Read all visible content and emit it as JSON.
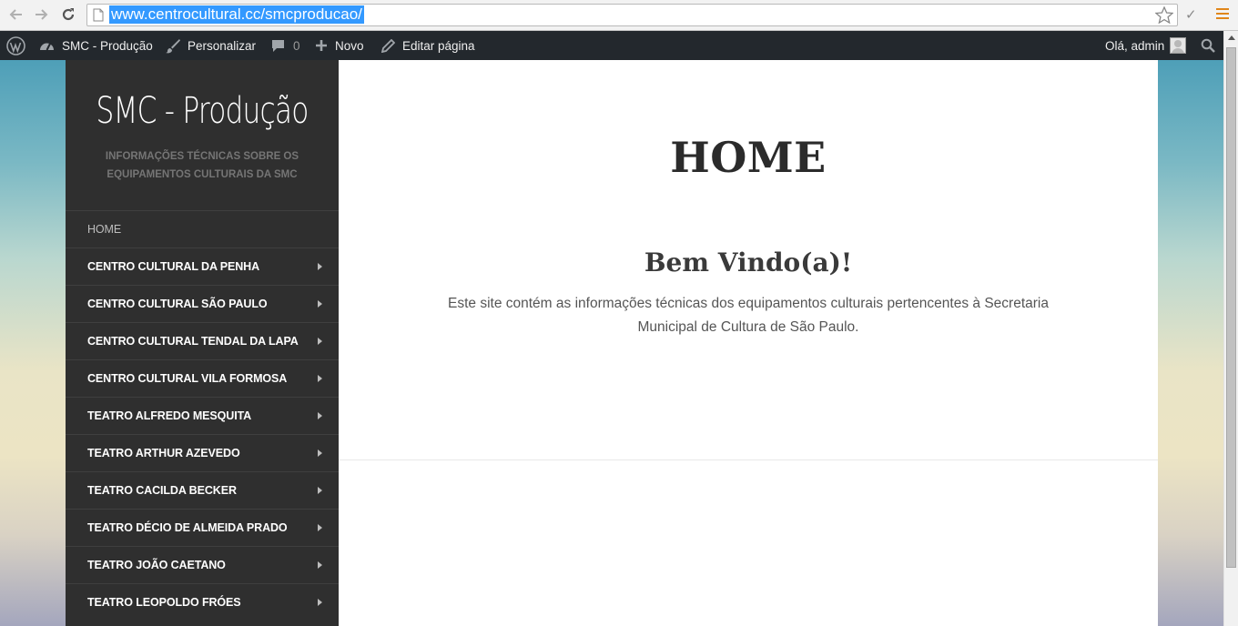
{
  "browser": {
    "url": "www.centrocultural.cc/smcproducao/"
  },
  "admin_bar": {
    "site_name": "SMC - Produção",
    "customize": "Personalizar",
    "comments_count": "0",
    "new": "Novo",
    "edit_page": "Editar página",
    "greeting": "Olá, admin"
  },
  "site": {
    "title": "SMC - Produção",
    "description": "INFORMAÇÕES TÉCNICAS SOBRE OS EQUIPAMENTOS CULTURAIS DA SMC"
  },
  "menu": {
    "items": [
      {
        "label": "HOME"
      },
      {
        "label": "CENTRO CULTURAL DA PENHA"
      },
      {
        "label": "CENTRO CULTURAL SÃO PAULO"
      },
      {
        "label": "CENTRO CULTURAL TENDAL DA LAPA"
      },
      {
        "label": "CENTRO CULTURAL VILA FORMOSA"
      },
      {
        "label": "TEATRO ALFREDO MESQUITA"
      },
      {
        "label": "TEATRO ARTHUR AZEVEDO"
      },
      {
        "label": "TEATRO CACILDA BECKER"
      },
      {
        "label": "TEATRO DÉCIO DE ALMEIDA PRADO"
      },
      {
        "label": "TEATRO JOÃO CAETANO"
      },
      {
        "label": "TEATRO LEOPOLDO FRÓES"
      }
    ]
  },
  "content": {
    "page_title": "HOME",
    "welcome": "Bem Vindo(a)!",
    "intro": "Este site contém as informações técnicas dos equipamentos culturais pertencentes à Secretaria Municipal de Cultura de São Paulo."
  }
}
